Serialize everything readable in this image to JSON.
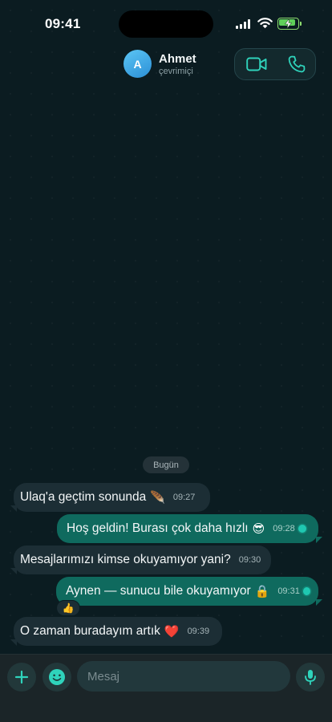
{
  "status_bar": {
    "time": "09:41"
  },
  "header": {
    "avatar_initial": "A",
    "contact_name": "Ahmet",
    "contact_status": "çevrimiçi",
    "video_icon": "video-camera-icon",
    "call_icon": "phone-icon"
  },
  "date_divider": "Bugün",
  "messages": [
    {
      "direction": "in",
      "text": "Ulaq'a geçtim sonunda",
      "emoji": "🪶",
      "time": "09:27"
    },
    {
      "direction": "out",
      "text": "Hoş geldin! Burası çok daha hızlı",
      "emoji": "😎",
      "time": "09:28"
    },
    {
      "direction": "in",
      "text": "Mesajlarımızı kimse okuyamıyor yani?",
      "emoji": "",
      "time": "09:30"
    },
    {
      "direction": "out",
      "text": "Aynen — sunucu bile okuyamıyor",
      "emoji": "🔒",
      "time": "09:31",
      "reaction": "👍"
    },
    {
      "direction": "in",
      "text": "O zaman buradayım artık",
      "emoji": "❤️",
      "time": "09:39"
    }
  ],
  "composer": {
    "placeholder": "Mesaj",
    "add_icon": "plus-icon",
    "emoji_icon": "smiley-icon",
    "mic_icon": "microphone-icon"
  },
  "colors": {
    "accent": "#1fc8b1",
    "outgoing_bubble": "#0f6a5e",
    "incoming_bubble": "#1c2e35",
    "background": "#0b1c21"
  }
}
